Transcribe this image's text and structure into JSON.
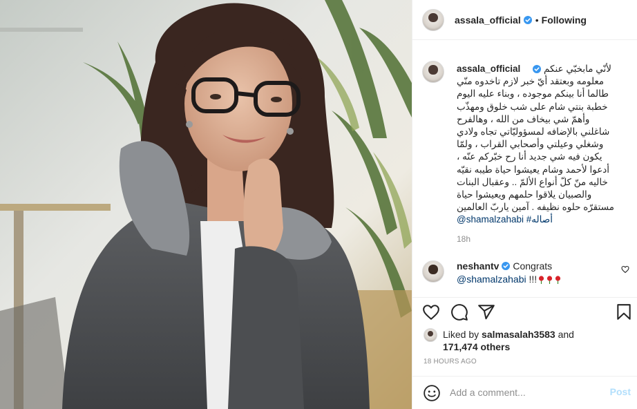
{
  "colors": {
    "link": "#00376b",
    "verified": "#3897f0",
    "muted": "#8e8e8e",
    "post_disabled": "#b2dffc",
    "divider": "#efefef"
  },
  "header": {
    "username": "assala_official",
    "dot": "•",
    "follow_status": "Following",
    "icons": [
      "verified-badge-icon"
    ]
  },
  "caption": {
    "username": "assala_official",
    "lines": [
      "لأنّي مابخبّي عنكم",
      "معلومه وبعتقد أيّ خبر لازم تاخدوه منّي",
      "طالما أنا بينكم موجوده ، وبناء عليه اليوم",
      "خطبة بنتي شام على شب خلوق ومهذّب",
      "وأهمّ شي بيخاف من الله ، وهالفرح",
      "شاغلني بالإضافه لمسؤوليّاتي تجاه ولادي",
      "وشغلي وعيلتي وأصحابي القراب ، ولمّا",
      "يكون فيه شي جديد أنا رح خبّركم عنّه ،",
      "أدعوا لأحمد وشام يعيشوا حياة طيبه نقيّه",
      "خاليه منّ كلّ أنواع الألمّ .. وعقبال البنات",
      "والصبيان يلاقوا حلمهم ويعيشوا حياة",
      "مستقرّه حلوه نظيفه . آمين ياربّ العالمين"
    ],
    "hashtag": "#أصاله",
    "mention": "@shamalzahabi",
    "time": "18h"
  },
  "comment": {
    "username": "neshantv",
    "text": "Congrats",
    "mention": "@shamalzahabi",
    "suffix": "!!!",
    "emoji": [
      "rose-icon",
      "rose-icon",
      "rose-icon"
    ]
  },
  "actions": {
    "icons": [
      "heart-icon",
      "comment-icon",
      "share-icon",
      "bookmark-icon"
    ]
  },
  "likes": {
    "prefix": "Liked by ",
    "user": "salmasalah3583",
    "and": " and",
    "count": "171,474 others"
  },
  "timestamp": "18 HOURS AGO",
  "add_comment": {
    "placeholder": "Add a comment...",
    "post_label": "Post",
    "icon": "emoji-smile-icon"
  }
}
